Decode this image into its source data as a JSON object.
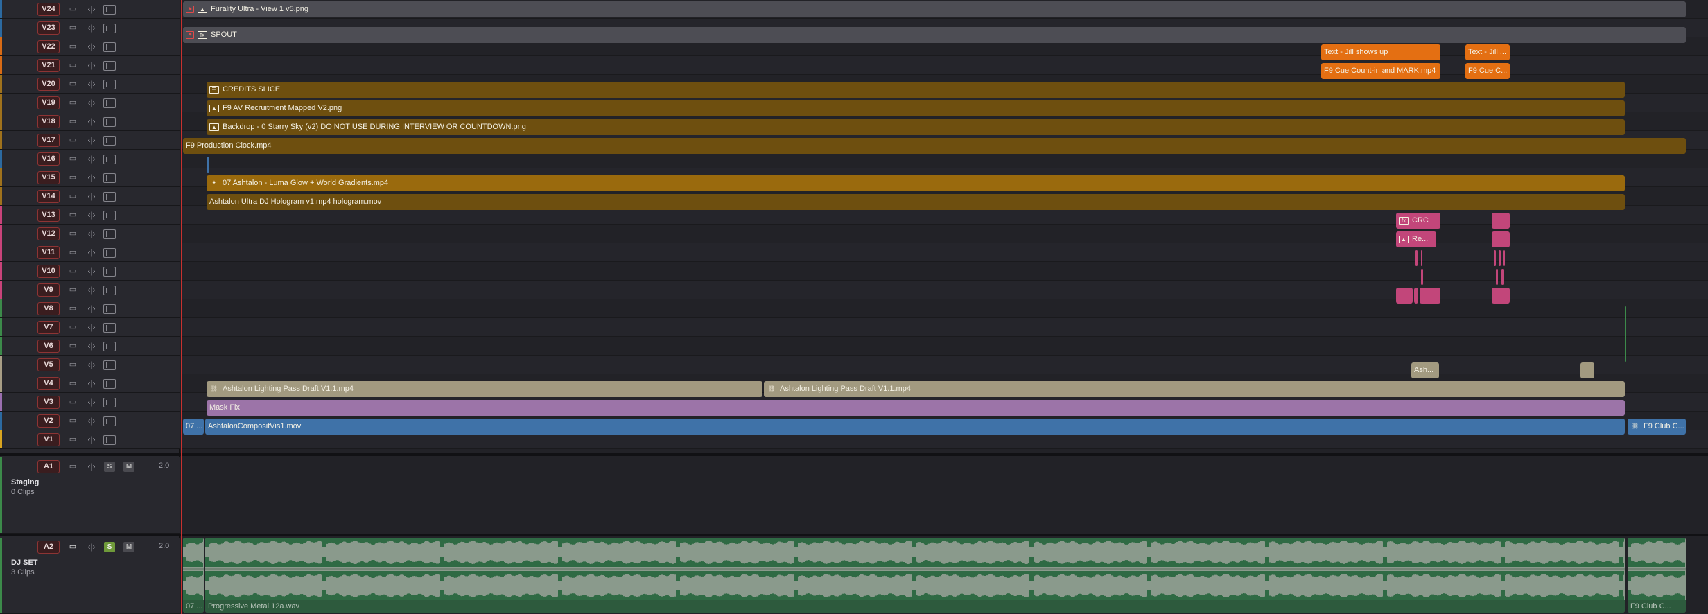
{
  "video_tracks": [
    {
      "name": "V24",
      "color": "#2c6aa1"
    },
    {
      "name": "V23",
      "color": "#2c6aa1"
    },
    {
      "name": "V22",
      "color": "#d96b15"
    },
    {
      "name": "V21",
      "color": "#d96b15"
    },
    {
      "name": "V20",
      "color": "#a0721c"
    },
    {
      "name": "V19",
      "color": "#a0721c"
    },
    {
      "name": "V18",
      "color": "#a0721c"
    },
    {
      "name": "V17",
      "color": "#a0721c"
    },
    {
      "name": "V16",
      "color": "#2c6aa1"
    },
    {
      "name": "V15",
      "color": "#a0721c"
    },
    {
      "name": "V14",
      "color": "#a0721c"
    },
    {
      "name": "V13",
      "color": "#c9437a"
    },
    {
      "name": "V12",
      "color": "#c9437a"
    },
    {
      "name": "V11",
      "color": "#c9437a"
    },
    {
      "name": "V10",
      "color": "#c9437a"
    },
    {
      "name": "V9",
      "color": "#c9437a"
    },
    {
      "name": "V8",
      "color": "#3c8a4a"
    },
    {
      "name": "V7",
      "color": "#3c8a4a"
    },
    {
      "name": "V6",
      "color": "#3c8a4a"
    },
    {
      "name": "V5",
      "color": "#a89e85"
    },
    {
      "name": "V4",
      "color": "#a89e85"
    },
    {
      "name": "V3",
      "color": "#9b6fb0"
    },
    {
      "name": "V2",
      "color": "#2c6aa1"
    },
    {
      "name": "V1",
      "color": "#d9a520"
    }
  ],
  "audio_tracks": [
    {
      "name": "A1",
      "channels": "2.0",
      "label": "Staging",
      "sub": "0 Clips",
      "solo": "S",
      "mute": "M"
    },
    {
      "name": "A2",
      "channels": "2.0",
      "label": "DJ SET",
      "sub": "3 Clips",
      "solo": "S",
      "mute": "M"
    }
  ],
  "clips": {
    "v24_a": "Furality Ultra - View 1 v5.png",
    "v23_a": "SPOUT",
    "v22_a": "Text - Jill shows up",
    "v22_b": "Text - Jill ...",
    "v21_a": "F9 Cue Count-in and MARK.mp4",
    "v21_b": "F9 Cue C...",
    "v20_a": "CREDITS SLICE",
    "v19_a": "F9 AV Recruitment Mapped V2.png",
    "v18_a": "Backdrop - 0 Starry Sky (v2) DO NOT USE DURING INTERVIEW OR COUNTDOWN.png",
    "v17_a": "F9 Production Clock.mp4",
    "v15_a": "07 Ashtalon - Luma Glow + World Gradients.mp4",
    "v14_a": "Ashtalon Ultra DJ Hologram v1.mp4 hologram.mov",
    "v13_a": "CRC",
    "v12_a": "Re...",
    "v5_a": "Ash...",
    "v4_a": "Ashtalon Lighting Pass Draft V1.1.mp4",
    "v4_b": "Ashtalon Lighting Pass Draft V1.1.mp4",
    "v3_a": "Mask Fix",
    "v2_a": "07 ...",
    "v2_b": "AshtalonCompositVis1.mov",
    "v2_c": "F9 Club C...",
    "a2_a": "07 ...",
    "a2_b": "Progressive Metal 12a.wav",
    "a2_c": "F9 Club C..."
  },
  "colors": {
    "text_clip": "#e46f12",
    "brown_clip": "#6e4f0f",
    "gold_clip": "#9a6a0d",
    "pink_clip": "#c2467a",
    "tan_clip": "#a29a80",
    "purple_clip": "#9c74a8",
    "blue_clip": "#3f72a8",
    "grey_clip": "#4a4a50",
    "audio_clip": "#2d5a3d",
    "playhead": "#c7312f"
  }
}
